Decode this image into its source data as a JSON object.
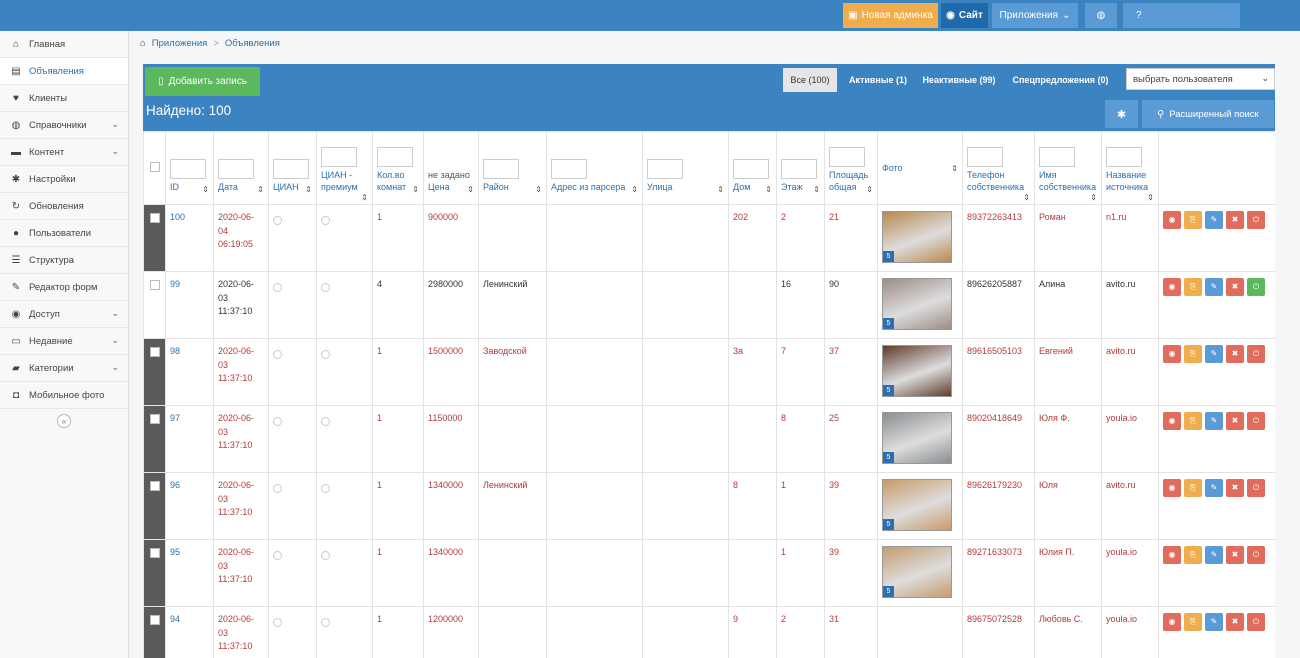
{
  "topbar": {
    "new_admin": "Новая админка",
    "site": "Сайт",
    "apps": "Приложения"
  },
  "sidebar": {
    "items": [
      {
        "label": "Главная",
        "icon": "home-icon",
        "glyph": "⌂",
        "chev": false
      },
      {
        "label": "Объявления",
        "icon": "book-icon",
        "glyph": "▤",
        "chev": false
      },
      {
        "label": "Клиенты",
        "icon": "heart-icon",
        "glyph": "♥",
        "chev": false
      },
      {
        "label": "Справочники",
        "icon": "globe-icon",
        "glyph": "◍",
        "chev": true
      },
      {
        "label": "Контент",
        "icon": "keyboard-icon",
        "glyph": "▬",
        "chev": true
      },
      {
        "label": "Настройки",
        "icon": "gear-icon",
        "glyph": "✱",
        "chev": false
      },
      {
        "label": "Обновления",
        "icon": "refresh-icon",
        "glyph": "↻",
        "chev": false
      },
      {
        "label": "Пользователи",
        "icon": "user-icon",
        "glyph": "●",
        "chev": false
      },
      {
        "label": "Структура",
        "icon": "list-icon",
        "glyph": "☰",
        "chev": false
      },
      {
        "label": "Редактор форм",
        "icon": "edit-icon",
        "glyph": "✎",
        "chev": false
      },
      {
        "label": "Доступ",
        "icon": "users-icon",
        "glyph": "◉",
        "chev": true
      },
      {
        "label": "Недавние",
        "icon": "desktop-icon",
        "glyph": "▭",
        "chev": true
      },
      {
        "label": "Категории",
        "icon": "folder-icon",
        "glyph": "▰",
        "chev": true
      },
      {
        "label": "Мобильное фото",
        "icon": "camera-icon",
        "glyph": "◘",
        "chev": false
      }
    ],
    "collapse": "«"
  },
  "breadcrumb": {
    "apps": "Приложения",
    "sep": ">",
    "current": "Объявления"
  },
  "toolbar": {
    "add": "Добавить запись",
    "filters": {
      "all": "Все (100)",
      "active": "Активные (1)",
      "inactive": "Неактивные (99)",
      "special": "Спецпредложения (0)"
    },
    "user_select": "выбрать пользователя"
  },
  "found": {
    "text": "Найдено: 100",
    "advanced": "Расширенный поиск"
  },
  "columns": {
    "id": "ID",
    "date": "Дата",
    "cian": "ЦИАН",
    "cian_premium": "ЦИАН - премиум",
    "rooms": "Кол.во комнат",
    "price_note": "не задано",
    "price": "Цена",
    "district": "Район",
    "parser_address": "Адрес из парсера",
    "street": "Улица",
    "house": "Дом",
    "floor": "Этаж",
    "area": "Площадь общая",
    "photo": "Фото",
    "owner_phone": "Телефон собственника",
    "owner_name": "Имя собственника",
    "source": "Название источника"
  },
  "rows": [
    {
      "id": "100",
      "date": "2020-06-04 06:19:05",
      "rooms": "1",
      "price": "900000",
      "district": "",
      "house": "202",
      "floor": "2",
      "area": "21",
      "photo_count": "5",
      "phone": "89372263413",
      "owner": "Роман",
      "source": "n1.ru",
      "selected": true,
      "active": false,
      "photo_color": "#b8894f"
    },
    {
      "id": "99",
      "date": "2020-06-03 11:37:10",
      "rooms": "4",
      "price": "2980000",
      "district": "Ленинский",
      "house": "",
      "floor": "16",
      "area": "90",
      "photo_count": "5",
      "phone": "89626205887",
      "owner": "Алина",
      "source": "avito.ru",
      "selected": false,
      "active": true,
      "photo_color": "#9b8c86"
    },
    {
      "id": "98",
      "date": "2020-06-03 11:37:10",
      "rooms": "1",
      "price": "1500000",
      "district": "Заводской",
      "house": "3а",
      "floor": "7",
      "area": "37",
      "photo_count": "5",
      "phone": "89616505103",
      "owner": "Евгений",
      "source": "avito.ru",
      "selected": true,
      "active": false,
      "photo_color": "#5e3b2a"
    },
    {
      "id": "97",
      "date": "2020-06-03 11:37:10",
      "rooms": "1",
      "price": "1150000",
      "district": "",
      "house": "",
      "floor": "8",
      "area": "25",
      "photo_count": "5",
      "phone": "89020418649",
      "owner": "Юля Ф.",
      "source": "youla.io",
      "selected": true,
      "active": false,
      "photo_color": "#8a8e90"
    },
    {
      "id": "96",
      "date": "2020-06-03 11:37:10",
      "rooms": "1",
      "price": "1340000",
      "district": "Ленинский",
      "house": "8",
      "floor": "1",
      "area": "39",
      "photo_count": "5",
      "phone": "89626179230",
      "owner": "Юля",
      "source": "avito.ru",
      "selected": true,
      "active": false,
      "photo_color": "#c99a68"
    },
    {
      "id": "95",
      "date": "2020-06-03 11:37:10",
      "rooms": "1",
      "price": "1340000",
      "district": "",
      "house": "",
      "floor": "1",
      "area": "39",
      "photo_count": "5",
      "phone": "89271633073",
      "owner": "Юлия П.",
      "source": "youla.io",
      "selected": true,
      "active": false,
      "photo_color": "#c49b70"
    },
    {
      "id": "94",
      "date": "2020-06-03 11:37:10",
      "rooms": "1",
      "price": "1200000",
      "district": "",
      "house": "9",
      "floor": "2",
      "area": "31",
      "photo_count": "",
      "phone": "89675072528",
      "owner": "Любовь С.",
      "source": "youla.io",
      "selected": true,
      "active": false,
      "photo_color": ""
    }
  ]
}
